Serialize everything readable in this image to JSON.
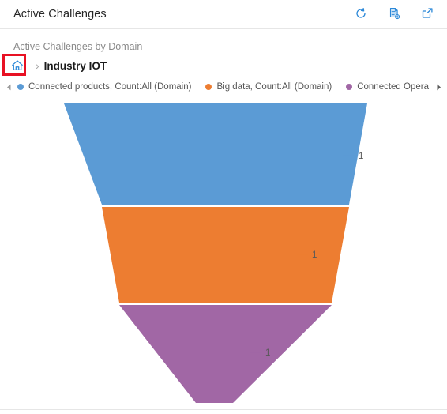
{
  "header": {
    "title": "Active Challenges",
    "actions": [
      {
        "name": "refresh-icon",
        "label": "Refresh"
      },
      {
        "name": "export-icon",
        "label": "Export"
      },
      {
        "name": "popout-icon",
        "label": "Open in new window"
      }
    ]
  },
  "chart_subtitle": "Active Challenges by Domain",
  "breadcrumb": {
    "home_label": "Home",
    "separator": "›",
    "current": "Industry IOT",
    "highlight_color": "#e81123"
  },
  "legend": {
    "prev_label": "◀",
    "next_label": "▶",
    "items": [
      {
        "label": "Connected products, Count:All (Domain)",
        "color": "#5b9bd5"
      },
      {
        "label": "Big data, Count:All (Domain)",
        "color": "#ed7d31"
      },
      {
        "label": "Connected Opera",
        "color": "#a167a5"
      }
    ]
  },
  "chart_data": {
    "type": "funnel",
    "title": "Active Challenges by Domain",
    "xlabel": "",
    "ylabel": "Count:All",
    "categories": [
      "Connected products, Count:All (Domain)",
      "Big data, Count:All (Domain)",
      "Connected Opera"
    ],
    "values": [
      1,
      1,
      1
    ],
    "labels": [
      "1",
      "1",
      "1"
    ],
    "colors": [
      "#5b9bd5",
      "#ed7d31",
      "#a167a5"
    ],
    "legend_position": "top",
    "grid": false
  }
}
